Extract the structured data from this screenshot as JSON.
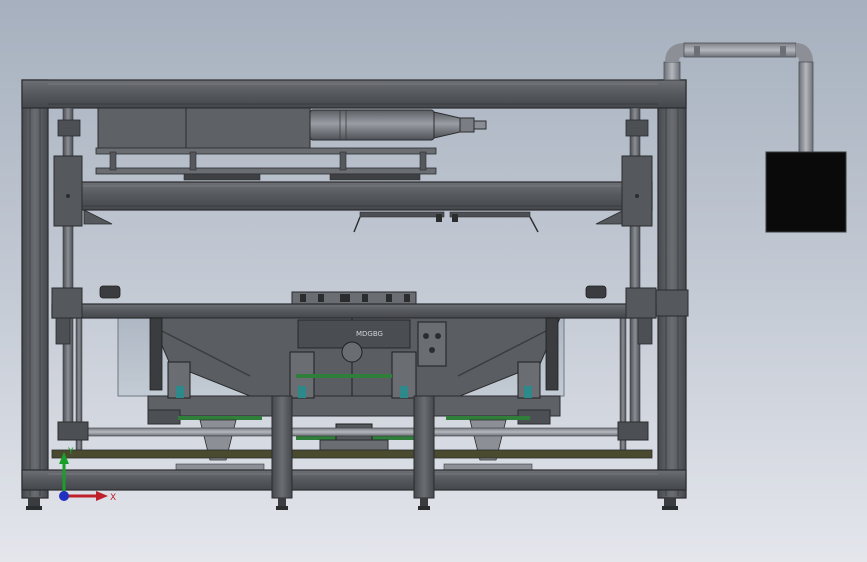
{
  "view": {
    "background_top": "#a6b0be",
    "background_bottom": "#e4e6ec",
    "frame_color": "#5c5f63",
    "frame_edge": "#2b2c2e",
    "accent_teal": "#2e8a8a",
    "accent_green": "#2f7f3a",
    "rail_olive": "#4a4a2e",
    "box_color": "#0a0a0a"
  },
  "plate": {
    "label": "MDGBG"
  },
  "triad": {
    "x_label": "X",
    "y_label": "Y",
    "x_color": "#c0202a",
    "y_color": "#1aa02a",
    "origin_color": "#2030c0"
  }
}
